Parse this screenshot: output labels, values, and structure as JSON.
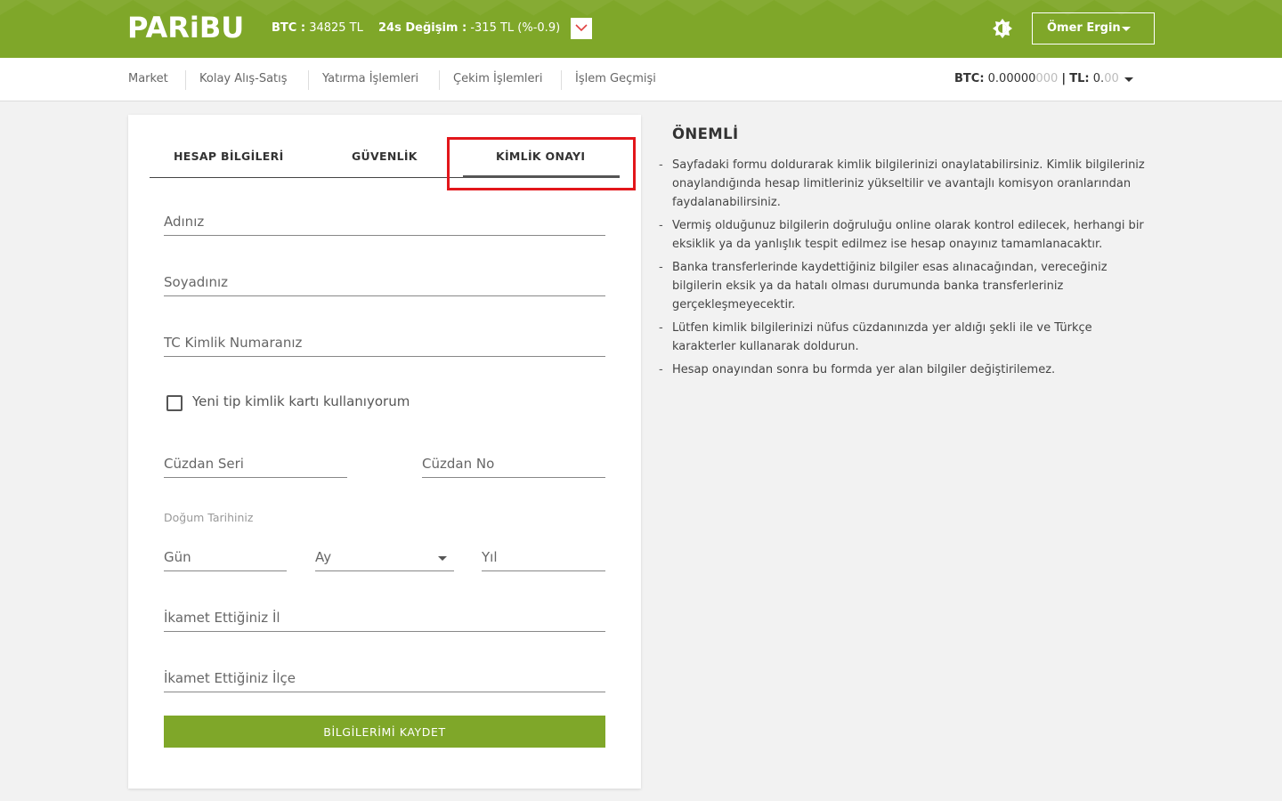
{
  "header": {
    "logo": "PARiBU",
    "btc_label": "BTC :",
    "btc_value": "34825 TL",
    "change_label": "24s Değişim :",
    "change_value": "-315 TL (%-0.9)",
    "ticker_toggle_icon": "chevron-down-icon",
    "theme_icon": "brightness-icon",
    "user_name": "Ömer Ergin"
  },
  "nav": {
    "items": [
      {
        "label": "Market"
      },
      {
        "label": "Kolay Alış-Satış"
      },
      {
        "label": "Yatırma İşlemleri"
      },
      {
        "label": "Çekim İşlemleri"
      },
      {
        "label": "İşlem Geçmişi"
      }
    ],
    "balance": {
      "btc_label": "BTC:",
      "btc_value": "0.00000",
      "btc_value_muted": "000",
      "separator": "|",
      "tl_label": "TL:",
      "tl_value": "0.",
      "tl_value_muted": "00"
    }
  },
  "tabs": [
    {
      "label": "HESAP BİLGİLERİ"
    },
    {
      "label": "GÜVENLİK"
    },
    {
      "label": "KİMLİK ONAYI",
      "active": true
    }
  ],
  "form": {
    "first_name_placeholder": "Adınız",
    "last_name_placeholder": "Soyadınız",
    "tc_placeholder": "TC Kimlik Numaranız",
    "new_id_checkbox_label": "Yeni tip kimlik kartı kullanıyorum",
    "wallet_serial_placeholder": "Cüzdan Seri",
    "wallet_no_placeholder": "Cüzdan No",
    "birth_date_label": "Doğum Tarihiniz",
    "day_placeholder": "Gün",
    "month_placeholder": "Ay",
    "year_placeholder": "Yıl",
    "city_placeholder": "İkamet Ettiğiniz İl",
    "district_placeholder": "İkamet Ettiğiniz İlçe",
    "save_label": "BİLGİLERİMİ KAYDET"
  },
  "info": {
    "title": "ÖNEMLİ",
    "items": [
      "Sayfadaki formu doldurarak kimlik bilgilerinizi onaylatabilirsiniz. Kimlik bilgileriniz onaylandığında hesap limitleriniz yükseltilir ve avantajlı komisyon oranlarından faydalanabilirsiniz.",
      "Vermiş olduğunuz bilgilerin doğruluğu online olarak kontrol edilecek, herhangi bir eksiklik ya da yanlışlık tespit edilmez ise hesap onayınız tamamlanacaktır.",
      "Banka transferlerinde kaydettiğiniz bilgiler esas alınacağından, vereceğiniz bilgilerin eksik ya da hatalı olması durumunda banka transferleriniz gerçekleşmeyecektir.",
      "Lütfen kimlik bilgilerinizi nüfus cüzdanınızda yer aldığı şekli ile ve Türkçe karakterler kullanarak doldurun.",
      "Hesap onayından sonra bu formda yer alan bilgiler değiştirilemez."
    ]
  },
  "colors": {
    "brand_green": "#7fa729",
    "highlight_red": "#e2161b"
  }
}
